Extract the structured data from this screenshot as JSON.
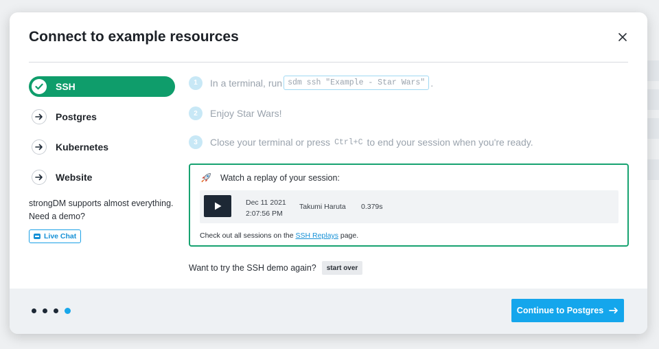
{
  "modal": {
    "title": "Connect to example resources",
    "close_icon": "close-icon"
  },
  "nav": {
    "items": [
      {
        "label": "SSH",
        "icon": "check-circle-icon",
        "active": true
      },
      {
        "label": "Postgres",
        "icon": "arrow-right-circle-icon",
        "active": false
      },
      {
        "label": "Kubernetes",
        "icon": "arrow-right-circle-icon",
        "active": false
      },
      {
        "label": "Website",
        "icon": "arrow-right-circle-icon",
        "active": false
      }
    ],
    "demo_text": "strongDM supports almost everything. Need a demo?",
    "live_chat_label": "Live Chat"
  },
  "steps": [
    {
      "num": "1",
      "text_before": "In a terminal, run",
      "code": "sdm ssh \"Example - Star Wars\"",
      "text_after": "."
    },
    {
      "num": "2",
      "text": "Enjoy Star Wars!"
    },
    {
      "num": "3",
      "text_before": "Close your terminal or press",
      "key": "Ctrl+C",
      "text_after": "to end your session when you're ready."
    }
  ],
  "replay": {
    "heading": "Watch a replay of your session:",
    "icon": "rocket-icon",
    "session": {
      "date": "Dec 11 2021",
      "time": "2:07:56 PM",
      "user": "Takumi Haruta",
      "duration": "0.379s"
    },
    "footer_before": "Check out all sessions on the",
    "footer_link": "SSH Replays",
    "footer_after": "page."
  },
  "try_again": {
    "text": "Want to try the SSH demo again?",
    "button": "start over"
  },
  "footer": {
    "total_dots": 4,
    "current_dot": 4,
    "continue_label": "Continue to Postgres"
  },
  "colors": {
    "active_green": "#0f9d6b",
    "accent_blue": "#14a6ec",
    "card_border": "#16a270"
  }
}
